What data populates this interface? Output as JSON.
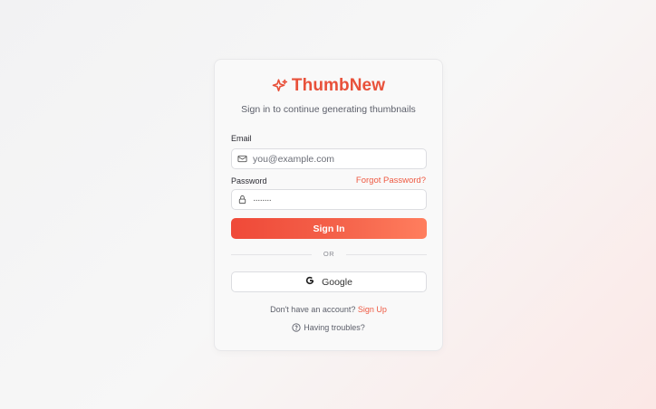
{
  "brand": {
    "name": "ThumbNew",
    "icon": "sparkle-icon",
    "color": "#e8513a"
  },
  "subtitle": "Sign in to continue generating thumbnails",
  "form": {
    "email_label": "Email",
    "email_placeholder": "you@example.com",
    "email_icon": "mail-icon",
    "password_label": "Password",
    "password_value": "········",
    "password_icon": "lock-icon",
    "forgot_label": "Forgot Password?",
    "signin_label": "Sign In"
  },
  "divider_text": "OR",
  "google": {
    "label": "Google",
    "icon": "google-icon"
  },
  "footer": {
    "prompt": "Don't have an account?",
    "signup_label": "Sign Up",
    "help_label": "Having troubles?",
    "help_icon": "question-circle-icon"
  },
  "colors": {
    "accent": "#ee5a43",
    "button_gradient_start": "#ef4938",
    "button_gradient_end": "#ff7e5e"
  }
}
